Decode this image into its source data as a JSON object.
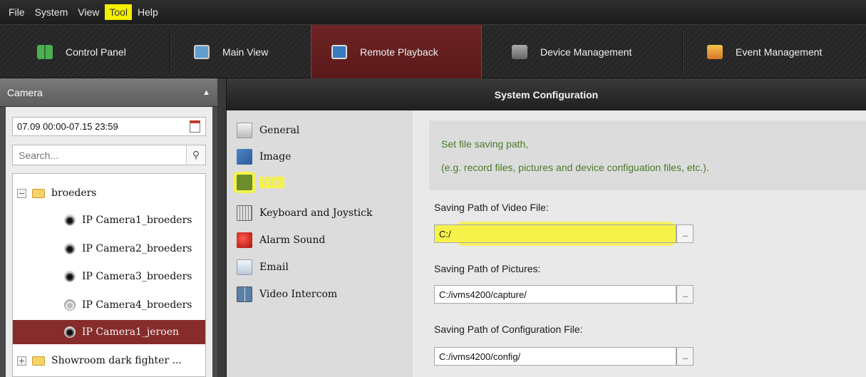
{
  "menu": [
    "File",
    "System",
    "View",
    "Tool",
    "Help"
  ],
  "menu_highlight": "Tool",
  "modules": [
    {
      "label": "Control Panel",
      "icon": "control-panel-icon",
      "color": "#4caf50"
    },
    {
      "label": "Main View",
      "icon": "main-view-icon",
      "color": "#5f9ecf"
    },
    {
      "label": "Remote Playback",
      "icon": "remote-playback-icon",
      "color": "#3a7abf"
    },
    {
      "label": "Device Management",
      "icon": "device-management-icon",
      "color": "#888888"
    },
    {
      "label": "Event Management",
      "icon": "event-management-icon",
      "color": "#e8a33a"
    }
  ],
  "active_module": "Remote Playback",
  "left_panel": {
    "title": "Camera",
    "date_range": "07.09 00:00-07.15 23:59",
    "search_placeholder": "Search...",
    "tree": [
      {
        "label": "broeders",
        "kind": "group",
        "expander": "−"
      },
      {
        "label": "IP Camera1_broeders",
        "kind": "camera"
      },
      {
        "label": "IP Camera2_broeders",
        "kind": "camera"
      },
      {
        "label": "IP Camera3_broeders",
        "kind": "camera"
      },
      {
        "label": "IP Camera4_broeders",
        "kind": "camera-offline"
      },
      {
        "label": "IP Camera1_jeroen",
        "kind": "camera",
        "selected": true
      },
      {
        "label": "Showroom dark fighter ...",
        "kind": "group",
        "expander": "+"
      }
    ]
  },
  "dialog": {
    "title": "System Configuration",
    "nav": [
      {
        "label": "General",
        "icon": "general-icon"
      },
      {
        "label": "Image",
        "icon": "image-icon"
      },
      {
        "label": "File",
        "icon": "file-icon",
        "highlighted": true
      },
      {
        "label": "Keyboard and Joystick",
        "icon": "keyboard-icon"
      },
      {
        "label": "Alarm Sound",
        "icon": "alarm-sound-icon"
      },
      {
        "label": "Email",
        "icon": "email-icon"
      },
      {
        "label": "Video Intercom",
        "icon": "video-intercom-icon"
      }
    ],
    "info_line1": "Set file saving path,",
    "info_line2": "(e.g. record files, pictures and device configuation files, etc.).",
    "video_label": "Saving Path of Video File:",
    "video_path": "C:/",
    "pictures_label": "Saving Path of Pictures:",
    "pictures_path": "C:/ivms4200/capture/",
    "config_label": "Saving Path of Configuration File:",
    "config_path": "C:/ivms4200/config/",
    "browse_label": "..."
  },
  "colors": {
    "accent_red": "#862c2a",
    "highlight_yellow": "#f6f24a",
    "info_green": "#4a7a2a"
  }
}
